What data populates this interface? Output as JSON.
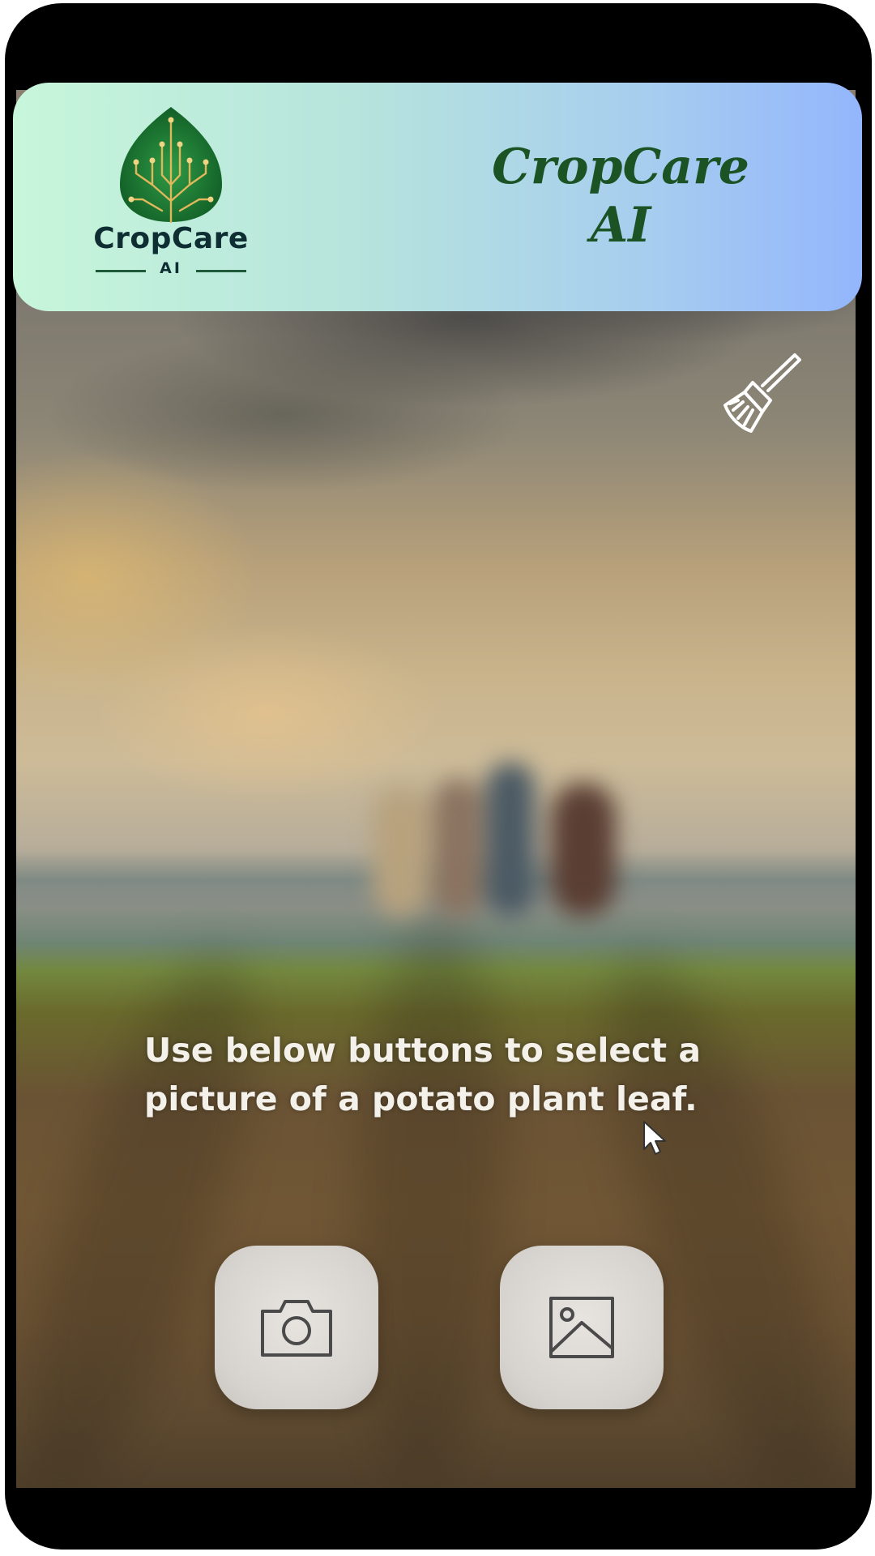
{
  "app": {
    "title": "CropCare AI",
    "title_line1": "CropCare",
    "title_line2": "AI"
  },
  "logo": {
    "name": "CropCare",
    "sub": "AI",
    "icon": "leaf-circuit-icon",
    "colors": {
      "leaf": "#1e7a35",
      "circuit": "#d4a84a"
    }
  },
  "header": {
    "gradient_start": "#c7f6db",
    "gradient_end": "#93b6fc",
    "title_color": "#1b5324"
  },
  "toolbar": {
    "clear_icon": "broom-icon"
  },
  "main": {
    "instruction": "Use below buttons to select a picture of a potato plant leaf."
  },
  "actions": [
    {
      "icon": "camera-icon"
    },
    {
      "icon": "image-gallery-icon"
    }
  ]
}
